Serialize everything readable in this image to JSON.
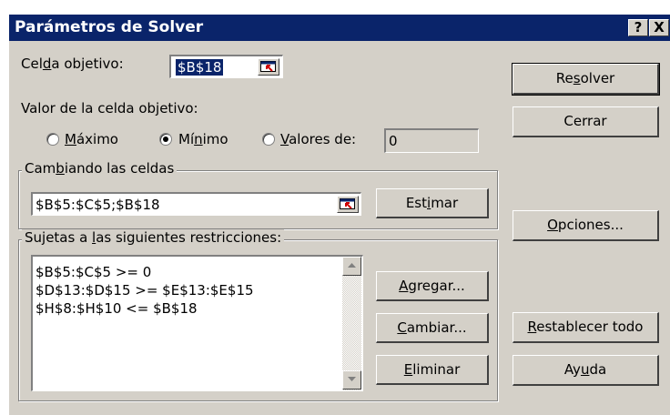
{
  "window": {
    "title": "Parámetros de Solver",
    "help_button": "?",
    "close_button": "X"
  },
  "target_cell": {
    "label_pre": "Cel",
    "label_key": "d",
    "label_post": "a objetivo:",
    "value": "$B$18"
  },
  "target_value": {
    "label": "Valor de la celda objetivo:",
    "options": [
      {
        "pre": "",
        "key": "M",
        "post": "áximo",
        "selected": false
      },
      {
        "pre": "Mí",
        "key": "n",
        "post": "imo",
        "selected": true
      },
      {
        "pre": "",
        "key": "V",
        "post": "alores de:",
        "selected": false
      }
    ],
    "value_of": "0"
  },
  "changing_cells": {
    "label_pre": "Cam",
    "label_key": "b",
    "label_post": "iando las celdas",
    "value": "$B$5:$C$5;$B$18",
    "guess_pre": "Est",
    "guess_key": "i",
    "guess_post": "mar"
  },
  "constraints": {
    "label_pre": "Sujetas a ",
    "label_key": "l",
    "label_post": "as siguientes restricciones:",
    "items": [
      "$B$5:$C$5 >= 0",
      "$D$13:$D$15 >= $E$13:$E$15",
      "$H$8:$H$10 <= $B$18"
    ],
    "add": {
      "pre": "",
      "key": "A",
      "post": "gregar..."
    },
    "change": {
      "pre": "",
      "key": "C",
      "post": "ambiar..."
    },
    "delete": {
      "pre": "",
      "key": "E",
      "post": "liminar"
    }
  },
  "buttons": {
    "solve": {
      "pre": "Re",
      "key": "s",
      "post": "olver"
    },
    "close": {
      "label": "Cerrar"
    },
    "options": {
      "pre": "",
      "key": "O",
      "post": "pciones..."
    },
    "reset": {
      "pre": "",
      "key": "R",
      "post": "establecer todo"
    },
    "help": {
      "pre": "Ay",
      "key": "u",
      "post": "da"
    }
  }
}
